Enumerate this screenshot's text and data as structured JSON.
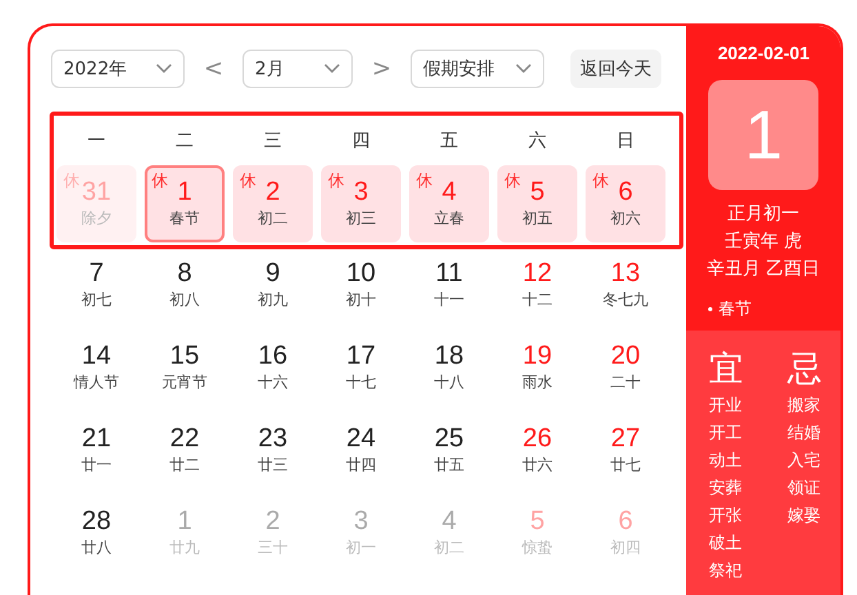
{
  "toolbar": {
    "year": "2022年",
    "prev": "<",
    "month": "2月",
    "next": ">",
    "mode": "假期安排",
    "today_button": "返回今天"
  },
  "highlight_first_week": true,
  "week_header": [
    "一",
    "二",
    "三",
    "四",
    "五",
    "六",
    "日"
  ],
  "weeks": [
    [
      {
        "day": "31",
        "lunar": "除夕",
        "rest": "休",
        "other_month": true,
        "selected": false
      },
      {
        "day": "1",
        "lunar": "春节",
        "rest": "休",
        "other_month": false,
        "selected": true
      },
      {
        "day": "2",
        "lunar": "初二",
        "rest": "休",
        "other_month": false,
        "selected": false
      },
      {
        "day": "3",
        "lunar": "初三",
        "rest": "休",
        "other_month": false,
        "selected": false
      },
      {
        "day": "4",
        "lunar": "立春",
        "rest": "休",
        "other_month": false,
        "selected": false
      },
      {
        "day": "5",
        "lunar": "初五",
        "rest": "休",
        "other_month": false,
        "selected": false
      },
      {
        "day": "6",
        "lunar": "初六",
        "rest": "休",
        "other_month": false,
        "selected": false
      }
    ],
    [
      {
        "day": "7",
        "lunar": "初七",
        "other_month": false,
        "weekend": false,
        "selected": false
      },
      {
        "day": "8",
        "lunar": "初八",
        "other_month": false,
        "weekend": false,
        "selected": false
      },
      {
        "day": "9",
        "lunar": "初九",
        "other_month": false,
        "weekend": false,
        "selected": false
      },
      {
        "day": "10",
        "lunar": "初十",
        "other_month": false,
        "weekend": false,
        "selected": false
      },
      {
        "day": "11",
        "lunar": "十一",
        "other_month": false,
        "weekend": false,
        "selected": false
      },
      {
        "day": "12",
        "lunar": "十二",
        "other_month": false,
        "weekend": true,
        "selected": false
      },
      {
        "day": "13",
        "lunar": "冬七九",
        "other_month": false,
        "weekend": true,
        "selected": false
      }
    ],
    [
      {
        "day": "14",
        "lunar": "情人节",
        "other_month": false,
        "weekend": false,
        "selected": false
      },
      {
        "day": "15",
        "lunar": "元宵节",
        "other_month": false,
        "weekend": false,
        "selected": false
      },
      {
        "day": "16",
        "lunar": "十六",
        "other_month": false,
        "weekend": false,
        "selected": false
      },
      {
        "day": "17",
        "lunar": "十七",
        "other_month": false,
        "weekend": false,
        "selected": false
      },
      {
        "day": "18",
        "lunar": "十八",
        "other_month": false,
        "weekend": false,
        "selected": false
      },
      {
        "day": "19",
        "lunar": "雨水",
        "other_month": false,
        "weekend": true,
        "selected": false
      },
      {
        "day": "20",
        "lunar": "二十",
        "other_month": false,
        "weekend": true,
        "selected": false
      }
    ],
    [
      {
        "day": "21",
        "lunar": "廿一",
        "other_month": false,
        "weekend": false,
        "selected": false
      },
      {
        "day": "22",
        "lunar": "廿二",
        "other_month": false,
        "weekend": false,
        "selected": false
      },
      {
        "day": "23",
        "lunar": "廿三",
        "other_month": false,
        "weekend": false,
        "selected": false
      },
      {
        "day": "24",
        "lunar": "廿四",
        "other_month": false,
        "weekend": false,
        "selected": false
      },
      {
        "day": "25",
        "lunar": "廿五",
        "other_month": false,
        "weekend": false,
        "selected": false
      },
      {
        "day": "26",
        "lunar": "廿六",
        "other_month": false,
        "weekend": true,
        "selected": false
      },
      {
        "day": "27",
        "lunar": "廿七",
        "other_month": false,
        "weekend": true,
        "selected": false
      }
    ],
    [
      {
        "day": "28",
        "lunar": "廿八",
        "other_month": false,
        "weekend": false,
        "selected": false
      },
      {
        "day": "1",
        "lunar": "廿九",
        "other_month": true,
        "weekend": false,
        "selected": false
      },
      {
        "day": "2",
        "lunar": "三十",
        "other_month": true,
        "weekend": false,
        "selected": false
      },
      {
        "day": "3",
        "lunar": "初一",
        "other_month": true,
        "weekend": false,
        "selected": false
      },
      {
        "day": "4",
        "lunar": "初二",
        "other_month": true,
        "weekend": false,
        "selected": false
      },
      {
        "day": "5",
        "lunar": "惊蛰",
        "other_month": true,
        "weekend": true,
        "selected": false
      },
      {
        "day": "6",
        "lunar": "初四",
        "other_month": true,
        "weekend": true,
        "selected": false
      }
    ]
  ],
  "side": {
    "date": "2022-02-01",
    "big_day": "1",
    "lunar_lines": [
      "正月初一",
      "壬寅年 虎",
      "辛丑月 乙酉日"
    ],
    "festivals": [
      "春节"
    ],
    "good": {
      "title": "宜",
      "items": [
        "开业",
        "开工",
        "动土",
        "安葬",
        "开张",
        "破土",
        "祭祀"
      ]
    },
    "bad": {
      "title": "忌",
      "items": [
        "搬家",
        "结婚",
        "入宅",
        "领证",
        "嫁娶"
      ]
    }
  }
}
